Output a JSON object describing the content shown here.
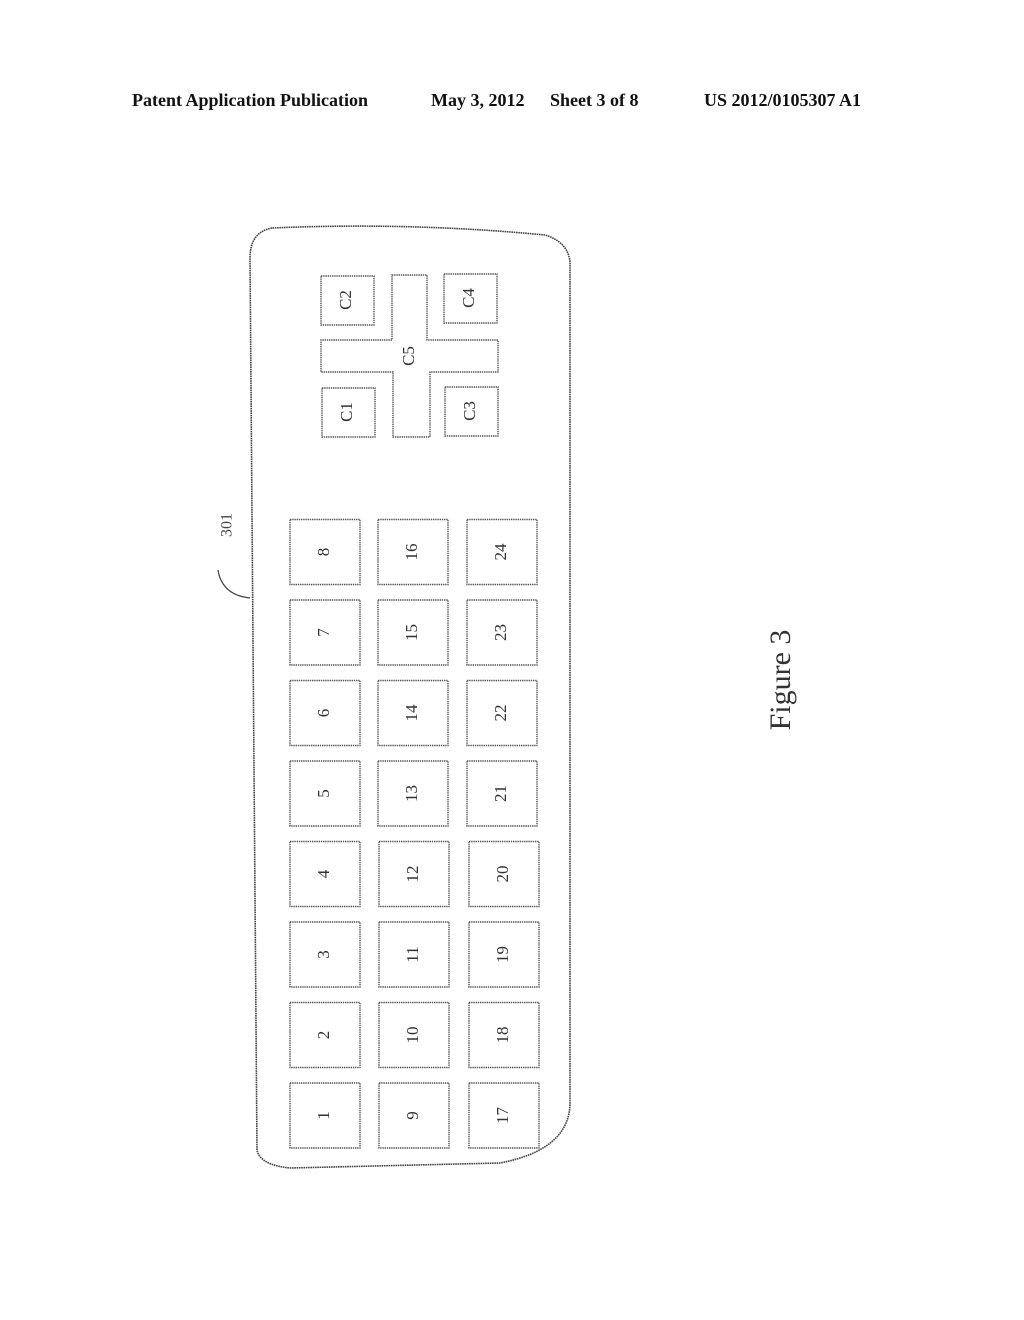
{
  "header": {
    "publication": "Patent Application Publication",
    "date": "May 3, 2012",
    "sheet": "Sheet 3 of 8",
    "number": "US 2012/0105307 A1"
  },
  "figure": {
    "caption": "Figure 3",
    "device_ref": "301",
    "control_keys": {
      "c1": "C1",
      "c2": "C2",
      "c3": "C3",
      "c4": "C4",
      "c5": "C5"
    },
    "key_grid": {
      "columns": [
        [
          "1",
          "2",
          "3",
          "4",
          "5",
          "6",
          "7",
          "8"
        ],
        [
          "9",
          "10",
          "11",
          "12",
          "13",
          "14",
          "15",
          "16"
        ],
        [
          "17",
          "18",
          "19",
          "20",
          "21",
          "22",
          "23",
          "24"
        ]
      ]
    }
  }
}
